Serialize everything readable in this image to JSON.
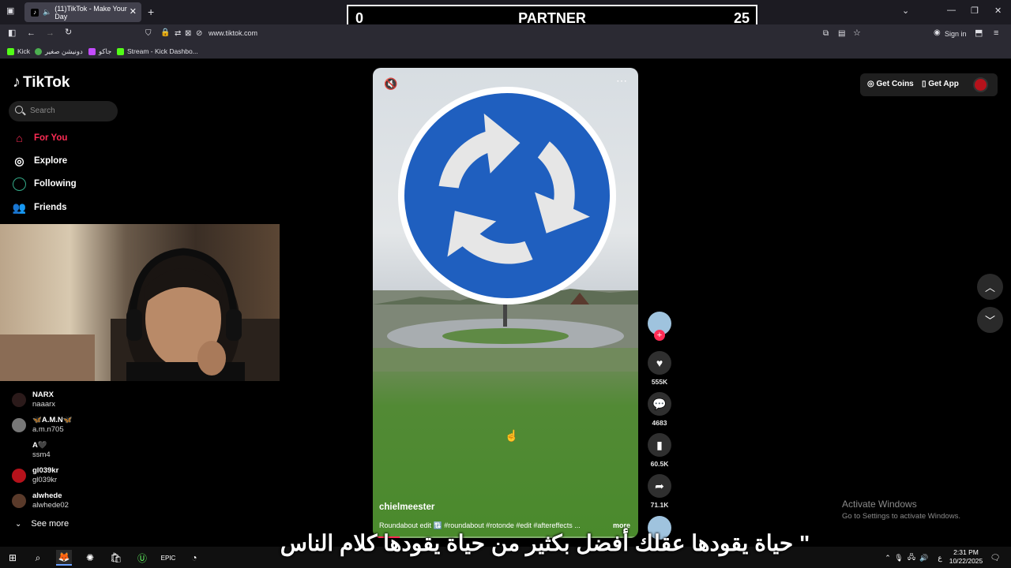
{
  "browser": {
    "tab_title": "(11)TikTok - Make Your Day",
    "url": "www.tiktok.com",
    "sign_in": "Sign in",
    "bookmarks": [
      "Kick",
      "دونيشن صغير",
      "جاكو",
      "Stream - Kick Dashbo..."
    ]
  },
  "scoreboard": {
    "left": "0",
    "center": "PARTNER",
    "right": "25"
  },
  "tiktok": {
    "logo": "TikTok",
    "search_placeholder": "Search",
    "nav": {
      "for_you": "For You",
      "explore": "Explore",
      "following": "Following",
      "friends": "Friends"
    },
    "following_accounts": [
      {
        "name": "NARX",
        "handle": "naaarx"
      },
      {
        "name": "🦋A.M.N🦋",
        "handle": "a.m.n705"
      },
      {
        "name": "A🖤",
        "handle": "ssm4"
      },
      {
        "name": "gl039kr",
        "handle": "gl039kr"
      },
      {
        "name": "alwhede",
        "handle": "alwhede02"
      }
    ],
    "see_more": "See more",
    "get_coins": "Get Coins",
    "get_app": "Get App",
    "video": {
      "creator": "chielmeester",
      "caption": "Roundabout edit 🔃 #roundabout #rotonde #edit #aftereffects ...",
      "more": "more",
      "progress": 0.1
    },
    "actions": {
      "likes": "555K",
      "comments": "4683",
      "saves": "60.5K",
      "shares": "71.1K"
    }
  },
  "activate_windows": {
    "title": "Activate Windows",
    "subtitle": "Go to Settings to activate Windows."
  },
  "subtitle_text": "\" حياة يقودها عقلك أفضل بكثير من حياة يقودها كلام الناس",
  "taskbar": {
    "time": "2:31 PM",
    "date": "10/22/2025",
    "lang": "ع"
  }
}
